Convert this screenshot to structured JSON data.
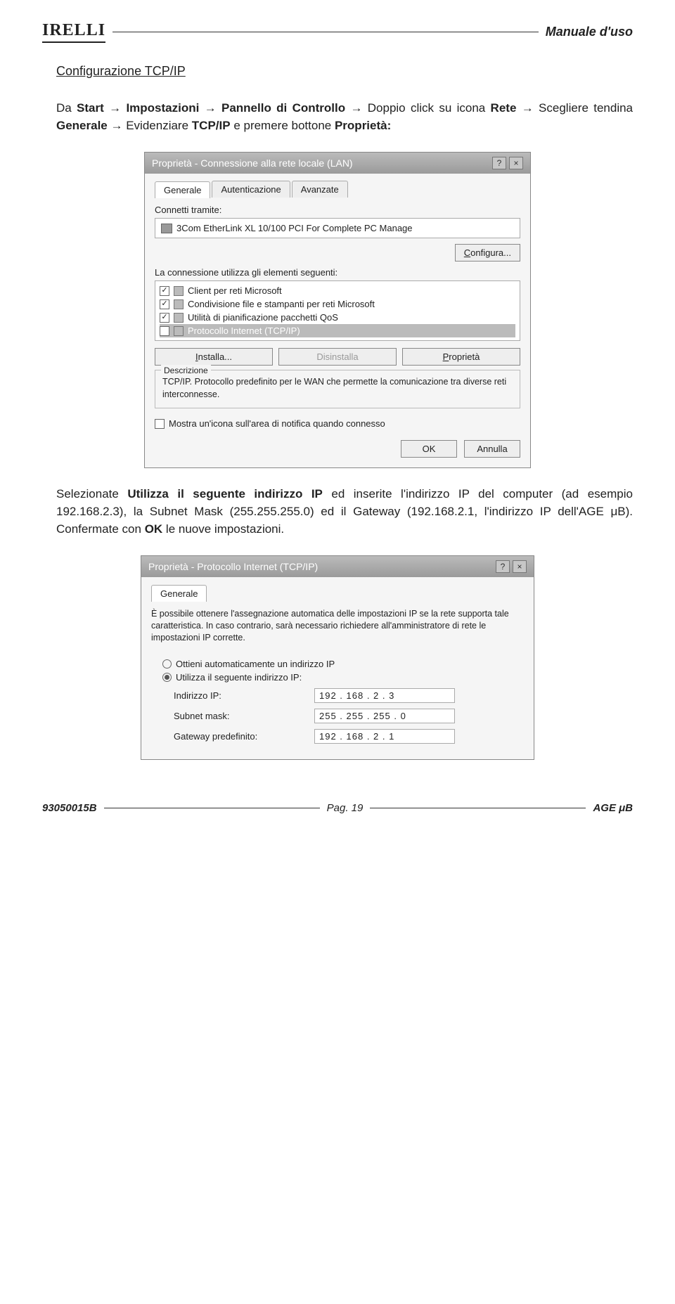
{
  "header": {
    "logo": "IRELLI",
    "manual": "Manuale d'uso"
  },
  "section_title": "Configurazione TCP/IP",
  "intro": {
    "pre": "Da ",
    "start": "Start",
    "arrow": " → ",
    "imp": "Impostazioni",
    "pannello": "Pannello di Controllo",
    "mid1": " → Doppio click su icona ",
    "rete": "Rete",
    "mid2": " → Scegliere tendina ",
    "generale": "Generale",
    "mid3": " → Evidenziare ",
    "tcpip": "TCP/IP",
    "mid4": " e premere bottone ",
    "prop": "Proprietà:"
  },
  "dlg1": {
    "title": "Proprietà - Connessione alla rete locale (LAN)",
    "help": "?",
    "close": "×",
    "tabs": {
      "generale": "Generale",
      "aut": "Autenticazione",
      "avanz": "Avanzate"
    },
    "connetti": "Connetti tramite:",
    "nic": "3Com EtherLink XL 10/100 PCI For Complete PC Manage",
    "configura": "Configura...",
    "lista_label": "La connessione utilizza gli elementi seguenti:",
    "items": [
      "Client per reti Microsoft",
      "Condivisione file e stampanti per reti Microsoft",
      "Utilità di pianificazione pacchetti QoS",
      "Protocollo Internet (TCP/IP)"
    ],
    "installa": "Installa...",
    "disinstalla": "Disinstalla",
    "proprieta": "Proprietà",
    "descr_legend": "Descrizione",
    "descr": "TCP/IP. Protocollo predefinito per le WAN che permette la comunicazione tra diverse reti interconnesse.",
    "mostra": "Mostra un'icona sull'area di notifica quando connesso",
    "ok": "OK",
    "annulla": "Annulla"
  },
  "para2": {
    "pre": "Selezionate ",
    "utilizza": "Utilizza il seguente indirizzo IP",
    "mid1": " ed inserite l'indirizzo IP del computer (ad esempio 192.168.2.3), la Subnet Mask (255.255.255.0) ed il Gateway (192.168.2.1, l'indirizzo IP dell'AGE μB). Confermate con ",
    "ok": "OK",
    "mid2": " le nuove impostazioni."
  },
  "dlg2": {
    "title": "Proprietà - Protocollo Internet (TCP/IP)",
    "help": "?",
    "close": "×",
    "tab": "Generale",
    "desc": "È possibile ottenere l'assegnazione automatica delle impostazioni IP se la rete supporta tale caratteristica. In caso contrario, sarà necessario richiedere all'amministratore di rete le impostazioni IP corrette.",
    "opt_auto": "Ottieni automaticamente un indirizzo IP",
    "opt_manual": "Utilizza il seguente indirizzo IP:",
    "ip_label": "Indirizzo IP:",
    "ip_val": "192 . 168 .  2  .  3",
    "mask_label": "Subnet mask:",
    "mask_val": "255 . 255 . 255 .  0",
    "gw_label": "Gateway predefinito:",
    "gw_val": "192 . 168 .  2  .  1"
  },
  "footer": {
    "doc": "93050015B",
    "page": "Pag. 19",
    "prod": "AGE μB"
  }
}
